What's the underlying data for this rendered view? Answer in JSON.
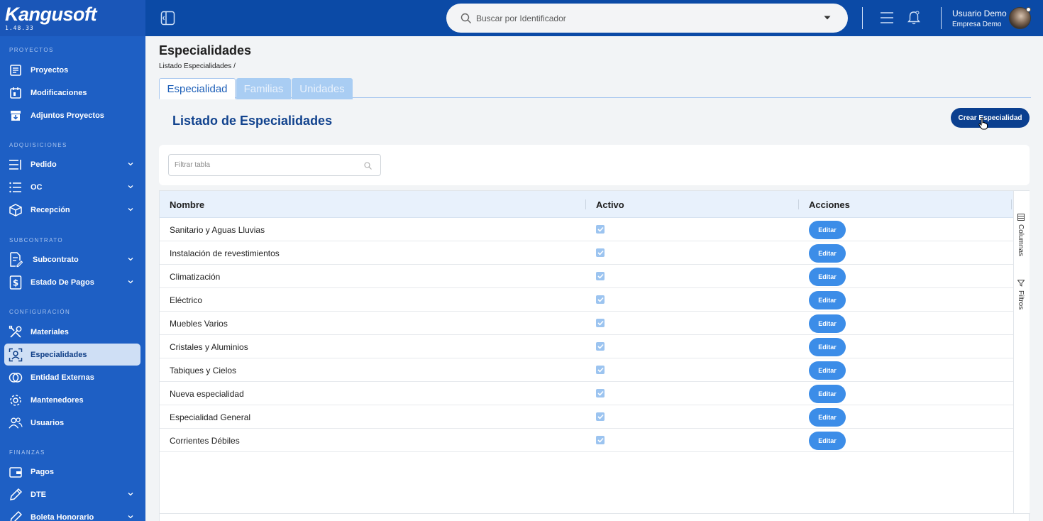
{
  "brand": {
    "logo": "Kangusoft",
    "version": "1.48.33"
  },
  "sidebar": {
    "sections": [
      {
        "title": "PROYECTOS",
        "items": [
          {
            "label": "Proyectos",
            "icon": "project-list-icon",
            "expandable": false
          },
          {
            "label": "Modificaciones",
            "icon": "calendar-edit-icon",
            "expandable": false
          },
          {
            "label": "Adjuntos Proyectos",
            "icon": "archive-download-icon",
            "expandable": false
          }
        ]
      },
      {
        "title": "ADQUISICIONES",
        "items": [
          {
            "label": "Pedido",
            "icon": "list-lines-icon",
            "expandable": true
          },
          {
            "label": "OC",
            "icon": "bullet-list-icon",
            "expandable": true
          },
          {
            "label": "Recepción",
            "icon": "box-icon",
            "expandable": true
          }
        ]
      },
      {
        "title": "SUBCONTRATO",
        "items": [
          {
            "label": "Subcontrato",
            "icon": "document-edit-icon",
            "expandable": true
          },
          {
            "label": "Estado De Pagos",
            "icon": "dollar-doc-icon",
            "expandable": true
          }
        ]
      },
      {
        "title": "CONFIGURACIÓN",
        "items": [
          {
            "label": "Materiales",
            "icon": "tools-icon",
            "expandable": false
          },
          {
            "label": "Especialidades",
            "icon": "user-focus-icon",
            "expandable": false,
            "active": true
          },
          {
            "label": "Entidad Externas",
            "icon": "link-circles-icon",
            "expandable": false
          },
          {
            "label": "Mantenedores",
            "icon": "gear-icon",
            "expandable": false
          },
          {
            "label": "Usuarios",
            "icon": "users-icon",
            "expandable": false
          }
        ]
      },
      {
        "title": "FINANZAS",
        "items": [
          {
            "label": "Pagos",
            "icon": "wallet-icon",
            "expandable": false
          },
          {
            "label": "DTE",
            "icon": "pencil-icon",
            "expandable": true
          },
          {
            "label": "Boleta Honorario",
            "icon": "pencil-icon",
            "expandable": true
          }
        ]
      }
    ]
  },
  "topbar": {
    "search_placeholder": "Buscar por Identificador",
    "user_name": "Usuario Demo",
    "company": "Empresa Demo"
  },
  "page": {
    "title": "Especialidades",
    "breadcrumb": "Listado Especialidades /",
    "tabs": [
      {
        "label": "Especialidad",
        "active": true
      },
      {
        "label": "Familias",
        "active": false
      },
      {
        "label": "Unidades",
        "active": false
      }
    ],
    "list_title": "Listado de Especialidades",
    "create_button": "Crear Especialidad",
    "filter_placeholder": "Filtrar tabla"
  },
  "table": {
    "columns": [
      "Nombre",
      "Activo",
      "Acciones"
    ],
    "rows": [
      {
        "name": "Sanitario y Aguas Lluvias",
        "active": true,
        "action": "Editar"
      },
      {
        "name": "Instalación de revestimientos",
        "active": true,
        "action": "Editar"
      },
      {
        "name": "Climatización",
        "active": true,
        "action": "Editar"
      },
      {
        "name": "Eléctrico",
        "active": true,
        "action": "Editar"
      },
      {
        "name": "Muebles Varios",
        "active": true,
        "action": "Editar"
      },
      {
        "name": "Cristales y Aluminios",
        "active": true,
        "action": "Editar"
      },
      {
        "name": "Tabiques y Cielos",
        "active": true,
        "action": "Editar"
      },
      {
        "name": "Nueva especialidad",
        "active": true,
        "action": "Editar"
      },
      {
        "name": "Especialidad General",
        "active": true,
        "action": "Editar"
      },
      {
        "name": "Corrientes Débiles",
        "active": true,
        "action": "Editar"
      }
    ],
    "side_tools": [
      "Columnas",
      "Filtros"
    ]
  },
  "colors": {
    "sidebar": "#1e5fc4",
    "topbar": "#0b4aa6",
    "primary_dark": "#0b3f8f",
    "edit_button": "#3c8de8"
  }
}
